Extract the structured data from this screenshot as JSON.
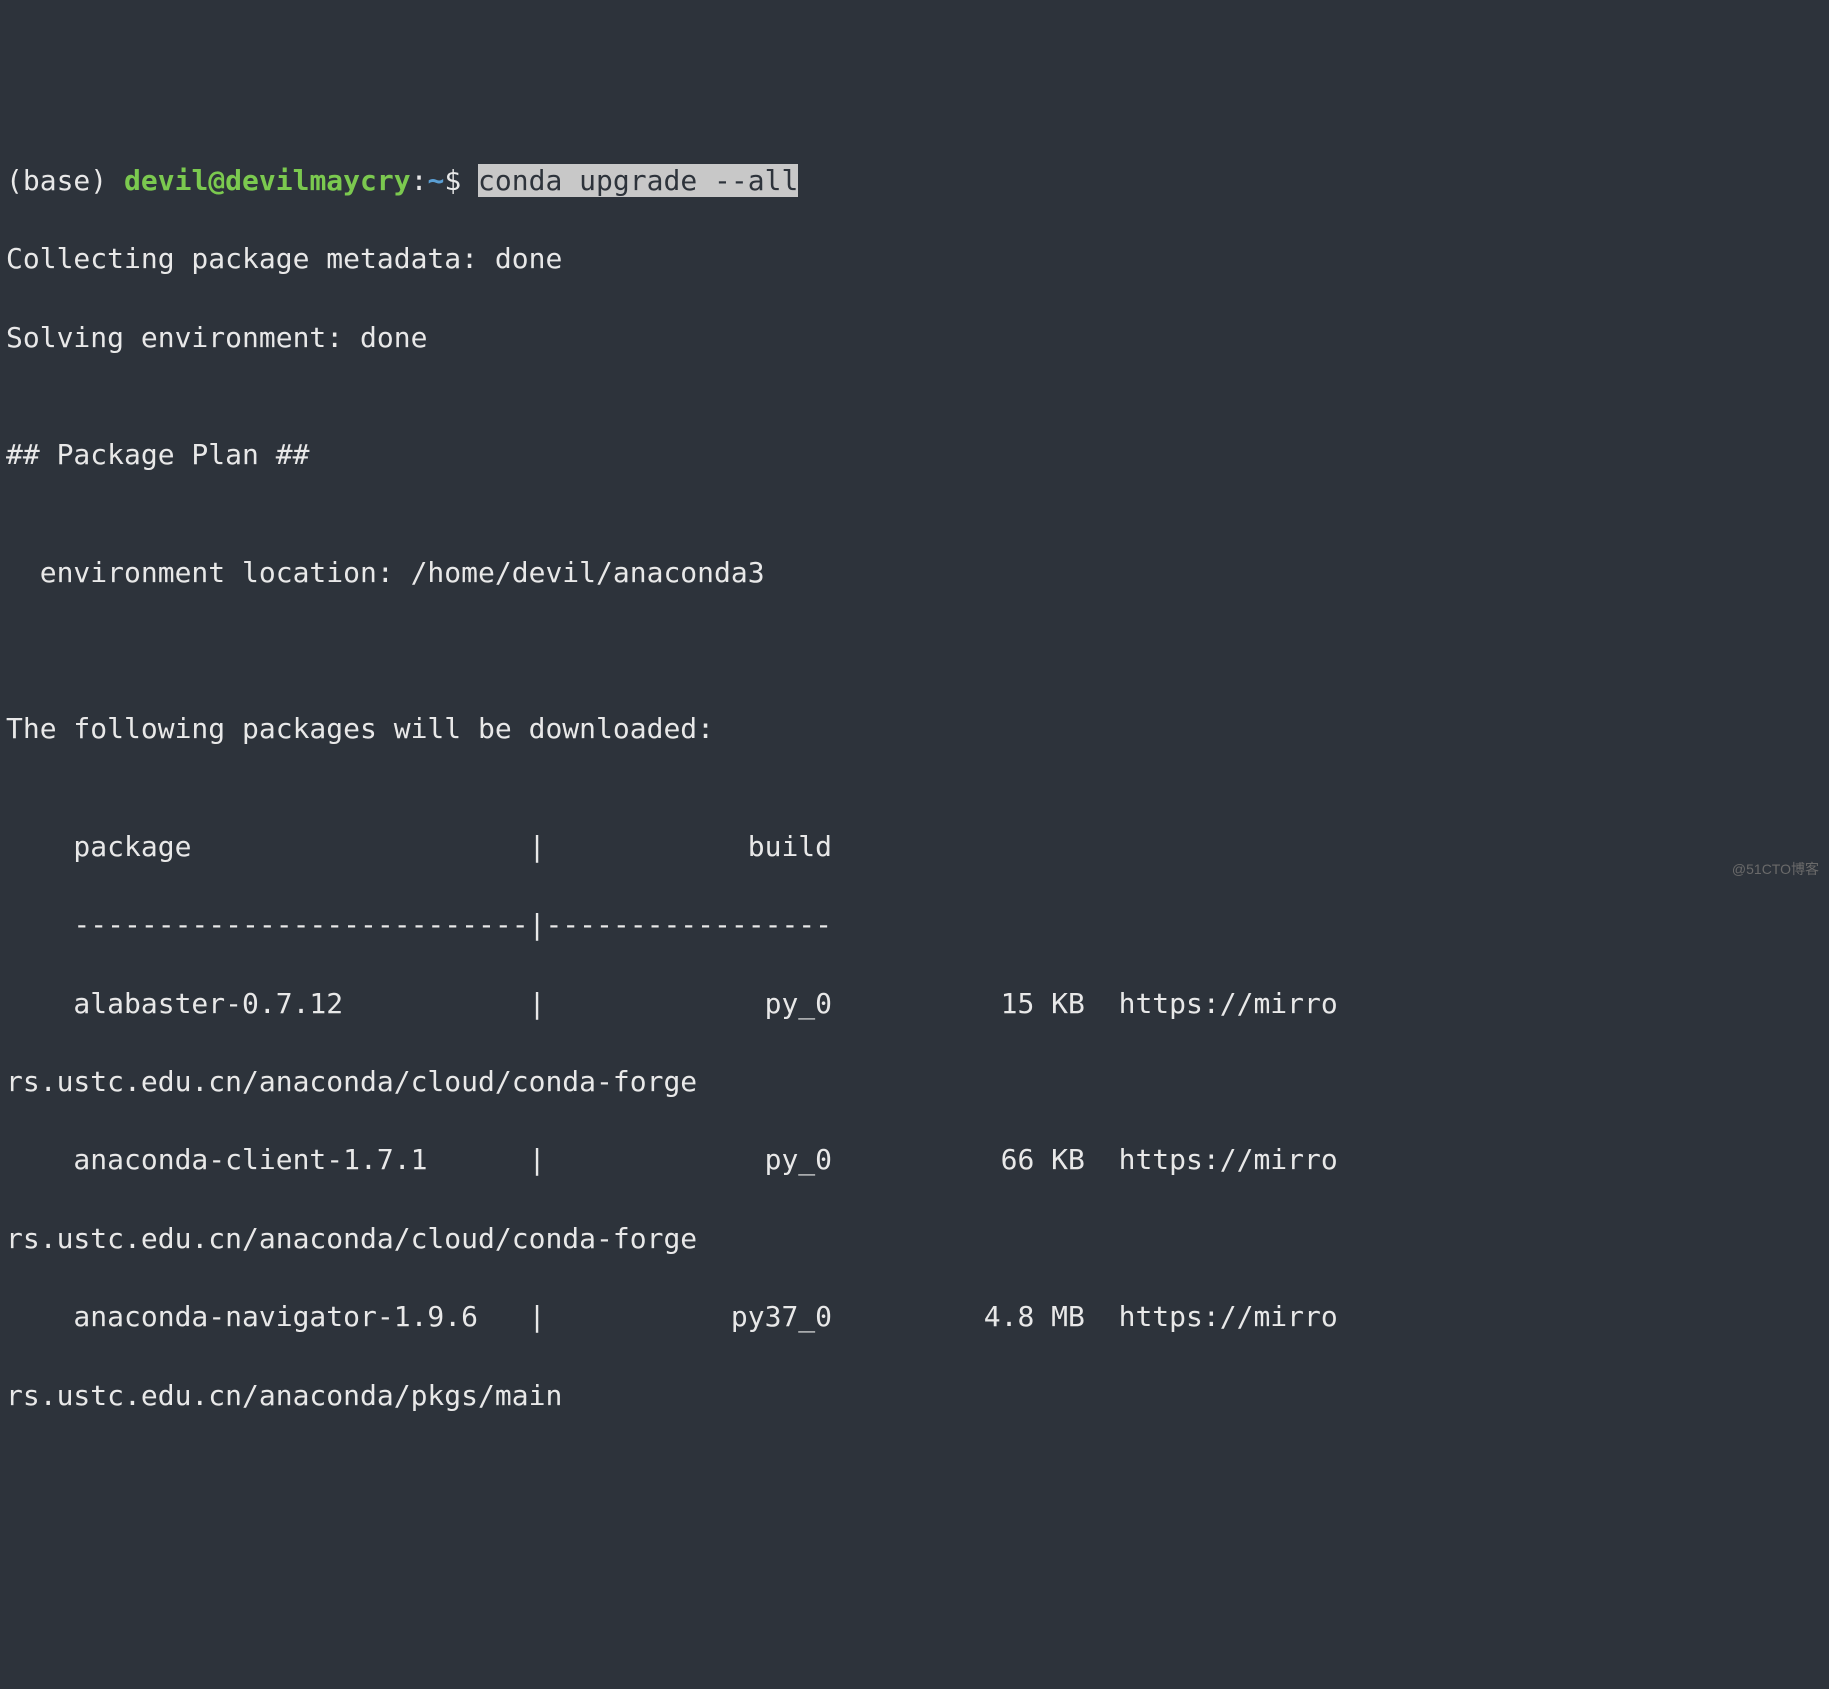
{
  "prompt": {
    "base": "(base) ",
    "user": "devil@devilmaycry",
    "colon": ":",
    "path": "~",
    "dollar": "$ "
  },
  "command": "conda upgrade --all",
  "lines": {
    "collecting": "Collecting package metadata: done",
    "solving": "Solving environment: done",
    "blank1": "",
    "plan_header": "## Package Plan ##",
    "blank2": "",
    "env_location": "  environment location: /home/devil/anaconda3",
    "blank3": "",
    "blank4": "",
    "download_header": "The following packages will be downloaded:",
    "blank5": "",
    "table_header": "    package                    |            build",
    "table_divider": "    ---------------------------|-----------------",
    "pkg1_line1": "    alabaster-0.7.12           |             py_0          15 KB  https://mirro",
    "pkg1_line2": "rs.ustc.edu.cn/anaconda/cloud/conda-forge",
    "pkg2_line1": "    anaconda-client-1.7.1      |             py_0          66 KB  https://mirro",
    "pkg2_line2": "rs.ustc.edu.cn/anaconda/cloud/conda-forge",
    "pkg3_line1": "    anaconda-navigator-1.9.6   |           py37_0         4.8 MB  https://mirro",
    "pkg3_line2": "rs.ustc.edu.cn/anaconda/pkgs/main"
  },
  "watermark": "@51CTO博客"
}
